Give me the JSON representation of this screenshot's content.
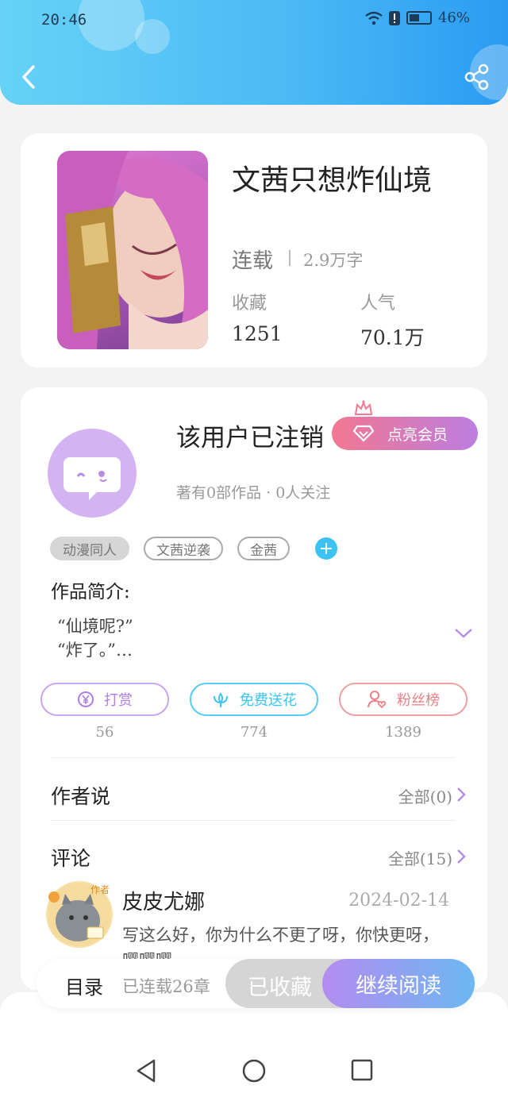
{
  "status_bar": {
    "time": "20:46",
    "battery": "46%"
  },
  "book": {
    "title": "文茜只想炸仙境",
    "status": "连载",
    "words": "2.9万字",
    "favorites_label": "收藏",
    "favorites_value": "1251",
    "popularity_label": "人气",
    "popularity_value": "70.1万"
  },
  "author": {
    "name": "该用户已注销",
    "vip_button": "点亮会员",
    "meta": "著有0部作品 · 0人关注",
    "tags": [
      "动漫同人",
      "文茜逆袭",
      "金茜"
    ],
    "intro_label": "作品简介:",
    "intro_text": "“仙境呢?”\n“炸了。”…"
  },
  "actions": [
    {
      "label": "打赏",
      "count": "56",
      "color": "#b07ee6"
    },
    {
      "label": "免费送花",
      "count": "774",
      "color": "#3cc3f4"
    },
    {
      "label": "粉丝榜",
      "count": "1389",
      "color": "#ee7f86"
    }
  ],
  "author_says": {
    "title": "作者说",
    "link": "全部(0)"
  },
  "comments": {
    "title": "评论",
    "link": "全部(15)",
    "first": {
      "badge": "作者",
      "name": "皮皮尤娜",
      "date": "2024-02-14",
      "text": "写这么好，你为什么不更了呀，你快更呀，嘤嘤嘤"
    }
  },
  "bottom_bar": {
    "toc_label": "目录",
    "toc_sub": "已连载26章",
    "fav_label": "已收藏",
    "read_label": "继续阅读"
  }
}
